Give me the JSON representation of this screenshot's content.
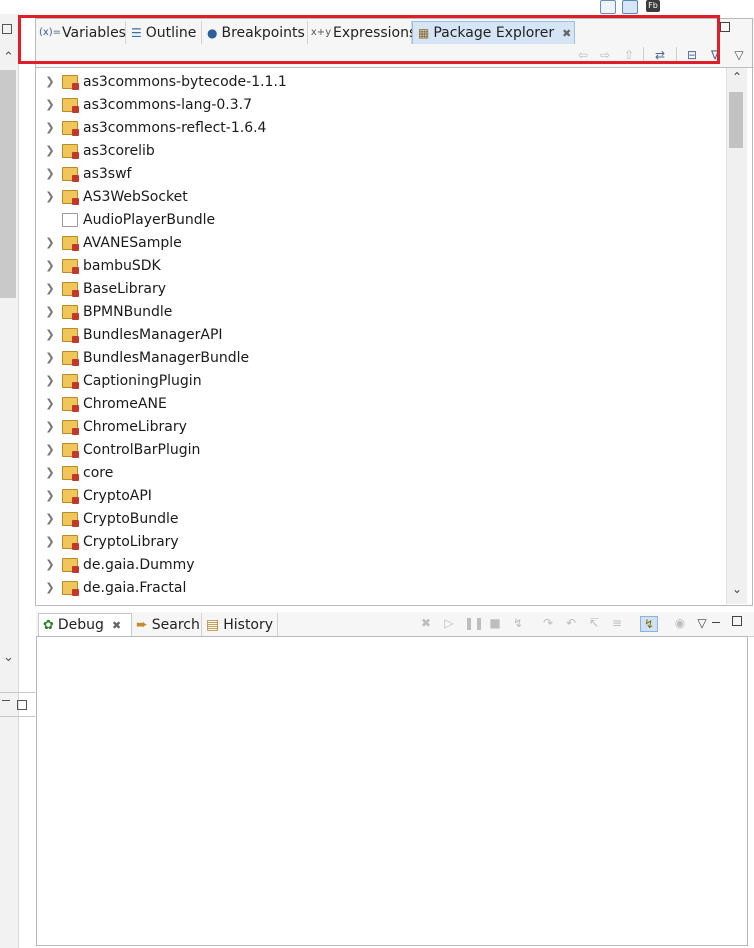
{
  "perspective_switcher": {
    "items": [
      {
        "icon": "open-perspective-icon"
      },
      {
        "icon": "flash-debug-perspective-icon"
      },
      {
        "icon": "flash-builder-perspective-icon",
        "label": "Fb"
      }
    ]
  },
  "upper_view": {
    "tabs": [
      {
        "label": "Variables",
        "icon": "variables-icon"
      },
      {
        "label": "Outline",
        "icon": "outline-icon"
      },
      {
        "label": "Breakpoints",
        "icon": "breakpoints-icon"
      },
      {
        "label": "Expressions",
        "icon": "expressions-icon"
      },
      {
        "label": "Package Explorer",
        "icon": "package-explorer-icon",
        "active": true,
        "closable": true
      }
    ],
    "toolbar_buttons": [
      "back-icon",
      "forward-icon",
      "up-icon",
      "link-with-editor-icon",
      "collapse-all-icon",
      "view-menu-icon"
    ],
    "tree_items": [
      {
        "label": "as3commons-bytecode-1.1.1",
        "expandable": true
      },
      {
        "label": "as3commons-lang-0.3.7",
        "expandable": true
      },
      {
        "label": "as3commons-reflect-1.6.4",
        "expandable": true
      },
      {
        "label": "as3corelib",
        "expandable": true
      },
      {
        "label": "as3swf",
        "expandable": true
      },
      {
        "label": "AS3WebSocket",
        "expandable": true
      },
      {
        "label": "AudioPlayerBundle",
        "expandable": false,
        "kind": "folder"
      },
      {
        "label": "AVANESample",
        "expandable": true
      },
      {
        "label": "bambuSDK",
        "expandable": true
      },
      {
        "label": "BaseLibrary",
        "expandable": true
      },
      {
        "label": "BPMNBundle",
        "expandable": true
      },
      {
        "label": "BundlesManagerAPI",
        "expandable": true
      },
      {
        "label": "BundlesManagerBundle",
        "expandable": true
      },
      {
        "label": "CaptioningPlugin",
        "expandable": true
      },
      {
        "label": "ChromeANE",
        "expandable": true
      },
      {
        "label": "ChromeLibrary",
        "expandable": true
      },
      {
        "label": "ControlBarPlugin",
        "expandable": true
      },
      {
        "label": "core",
        "expandable": true
      },
      {
        "label": "CryptoAPI",
        "expandable": true
      },
      {
        "label": "CryptoBundle",
        "expandable": true
      },
      {
        "label": "CryptoLibrary",
        "expandable": true
      },
      {
        "label": "de.gaia.Dummy",
        "expandable": true
      },
      {
        "label": "de.gaia.Fractal",
        "expandable": true
      }
    ]
  },
  "lower_view": {
    "tabs": [
      {
        "label": "Debug",
        "icon": "debug-icon",
        "active": true,
        "closable": true
      },
      {
        "label": "Search",
        "icon": "search-icon"
      },
      {
        "label": "History",
        "icon": "history-icon"
      }
    ],
    "toolbar_buttons": [
      "remove-terminated-icon",
      "resume-icon",
      "suspend-icon",
      "terminate-icon",
      "disconnect-icon",
      "step-into-icon",
      "step-over-icon",
      "step-return-icon",
      "drop-to-frame-icon",
      "use-step-filters-icon",
      "threads-icon",
      "view-menu-icon"
    ]
  },
  "colors": {
    "highlight_box": "#e01e2a",
    "active_tab": "#d5e5f6",
    "project_icon": "#f0c55a"
  }
}
